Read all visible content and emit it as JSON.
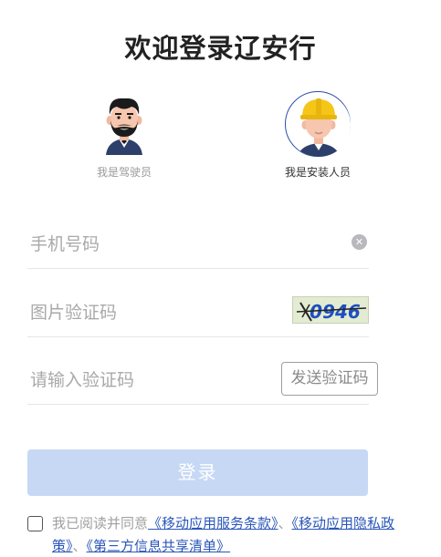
{
  "page": {
    "title": "欢迎登录辽安行"
  },
  "roles": {
    "driver": {
      "label": "我是驾驶员",
      "selected": false
    },
    "installer": {
      "label": "我是安装人员",
      "selected": true
    }
  },
  "form": {
    "phone_placeholder": "手机号码",
    "captcha_placeholder": "图片验证码",
    "captcha_text": "0946",
    "sms_placeholder": "请输入验证码",
    "sms_button": "发送验证码",
    "login_button": "登录"
  },
  "agreement": {
    "prefix": "我已阅读并同意",
    "links": [
      "《移动应用服务条款》",
      "《移动应用隐私政策》",
      "《第三方信息共享清单》"
    ],
    "separator": "、"
  },
  "colors": {
    "primary_link": "#2a56b8",
    "login_disabled": "#c6d8f4",
    "avatar_border": "#2a4da8",
    "helmet": "#f5c518"
  }
}
